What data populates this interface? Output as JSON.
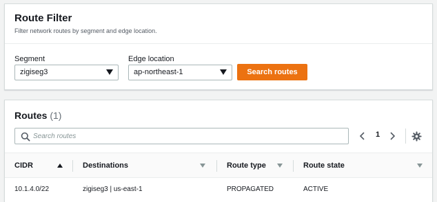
{
  "filter": {
    "title": "Route Filter",
    "description": "Filter network routes by segment and edge location.",
    "segment_label": "Segment",
    "segment_value": "zigiseg3",
    "edge_label": "Edge location",
    "edge_value": "ap-northeast-1",
    "search_button": "Search routes"
  },
  "routes": {
    "title": "Routes",
    "count": "(1)",
    "search_placeholder": "Search routes",
    "current_page": "1",
    "columns": [
      "CIDR",
      "Destinations",
      "Route type",
      "Route state"
    ],
    "rows": [
      {
        "cidr": "10.1.4.0/22",
        "destinations": "zigiseg3 | us-east-1",
        "route_type": "PROPAGATED",
        "route_state": "ACTIVE"
      }
    ]
  },
  "colors": {
    "primary_button": "#ec7211",
    "background": "#f2f3f3",
    "border": "#d5dbdb"
  },
  "icons": [
    "search-icon",
    "chevron-left-icon",
    "chevron-right-icon",
    "gear-icon",
    "caret-down-icon",
    "sort-ascending-icon",
    "sort-icon"
  ]
}
